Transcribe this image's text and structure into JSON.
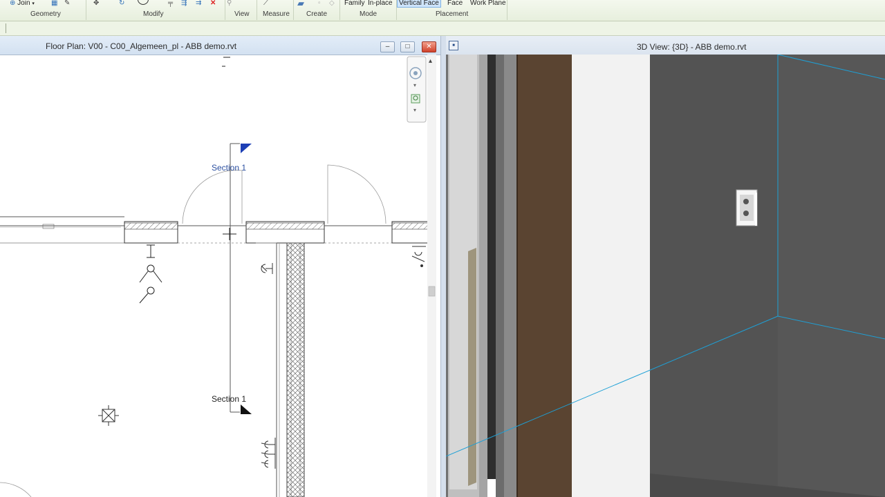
{
  "ribbon": {
    "join_label": "Join",
    "groups": {
      "geometry": "Geometry",
      "modify": "Modify",
      "view": "View",
      "measure": "Measure",
      "create": "Create",
      "mode": "Mode",
      "placement": "Placement"
    },
    "mode_buttons": {
      "family": "Family",
      "in_place": "In-place"
    },
    "placement_buttons": {
      "vertical_face": "Vertical Face",
      "face": "Face",
      "work_plane": "Work Plane"
    }
  },
  "floor_plan": {
    "title": "Floor Plan: V00 - C00_Algemeen_pl - ABB demo.rvt",
    "section_top_label": "Section 1",
    "section_bottom_label": "Section 1",
    "window_buttons": {
      "minimize": "–",
      "restore": "□",
      "close": "✕"
    }
  },
  "view_3d": {
    "title": "3D View: {3D} - ABB demo.rvt"
  },
  "colors": {
    "section_marker": "#1d3fb5",
    "wall_dark": "#545454",
    "door_wood": "#5a4431",
    "guide_line": "#1ea0d6",
    "ribbon_bg": "#eef4e6"
  },
  "icons": [
    "join-icon",
    "cut-icon",
    "move-icon",
    "rotate-icon",
    "delete-icon",
    "measure-icon",
    "create-icon",
    "nav-wheel-icon",
    "zoom-icon",
    "electrical-outlet-icon",
    "revit-view-icon"
  ]
}
